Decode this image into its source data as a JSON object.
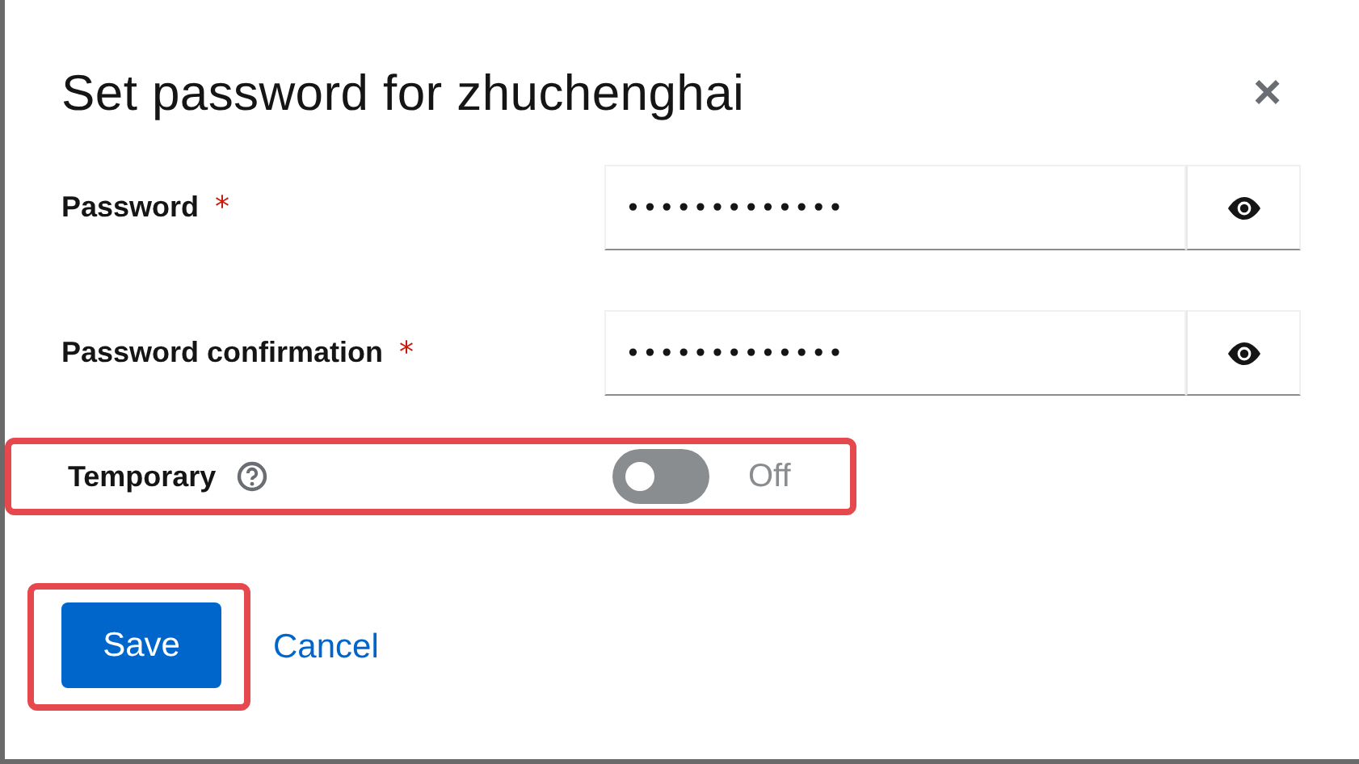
{
  "dialog": {
    "title": "Set password for zhuchenghai",
    "close_icon": "×"
  },
  "fields": [
    {
      "label": "Password",
      "required_mark": "*",
      "value": "•••••••••••••"
    },
    {
      "label": "Password confirmation",
      "required_mark": "*",
      "value": "•••••••••••••"
    }
  ],
  "temporary": {
    "label": "Temporary",
    "on": false,
    "state_label": "Off",
    "highlighted": true
  },
  "actions": {
    "save": "Save",
    "cancel": "Cancel",
    "save_highlighted": true
  }
}
